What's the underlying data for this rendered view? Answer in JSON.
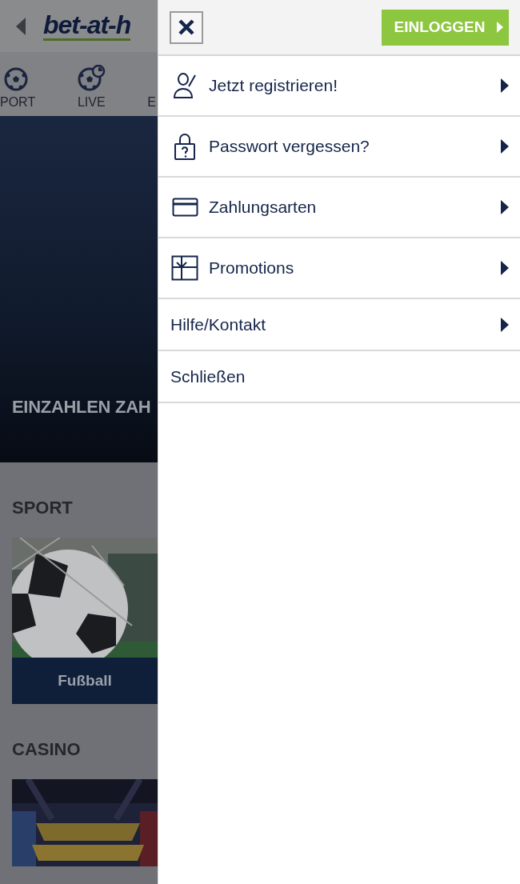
{
  "header": {
    "logo": "bet-at-h"
  },
  "nav": [
    {
      "label": "PORT"
    },
    {
      "label": "LIVE"
    },
    {
      "label": "E"
    }
  ],
  "hero": {
    "title": "EINZAHLEN ZAH"
  },
  "sections": [
    {
      "title": "SPORT",
      "card": {
        "kind": "picture",
        "label": "Fußball"
      }
    },
    {
      "title": "CASINO"
    }
  ],
  "drawer": {
    "login_button": "EINLOGGEN",
    "items": [
      {
        "label": "Jetzt registrieren!",
        "arrow": true
      },
      {
        "label": "Passwort vergessen?",
        "arrow": true
      },
      {
        "label": "Zahlungsarten",
        "arrow": true
      },
      {
        "label": "Promotions",
        "arrow": true
      },
      {
        "label": "Hilfe/Kontakt",
        "arrow": true
      },
      {
        "label": "Schließen",
        "arrow": false
      }
    ]
  }
}
